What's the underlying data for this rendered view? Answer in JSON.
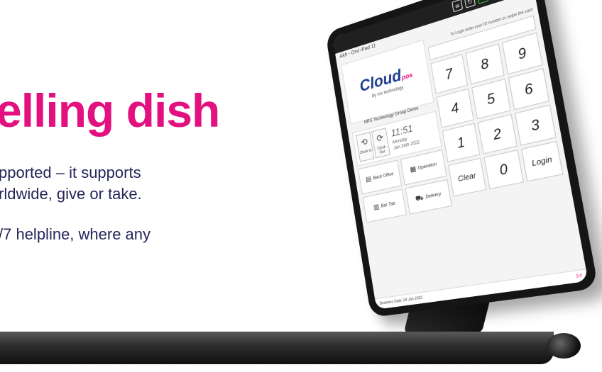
{
  "hero": {
    "headline": "elling dish",
    "para1_line1": "pported – it supports",
    "para1_line2": "rldwide, give or take.",
    "para2_line1": "/7 helpline, where any"
  },
  "pos": {
    "topbar_icons": [
      "clipboard-icon",
      "refresh-icon",
      "monitor-icon",
      "tablet-icon",
      "globe-icon",
      "logout-icon"
    ],
    "title": "Akh - Orvi iPad 11",
    "logo_main": "Cloud",
    "logo_suffix": "pos",
    "logo_sub": "by nrs technology",
    "company": "NRS Technology Group Demo",
    "clock_in": "Clock In",
    "clock_out": "Clock Out",
    "time": "11:51",
    "day": "Monday",
    "date": "Jan 24th 2022",
    "back_office": "Back Office",
    "operation": "Operation",
    "bar_tab": "Bar Tab",
    "delivery": "Delivery",
    "login_hint": "To Login enter your ID number or swipe the card",
    "keys": [
      "7",
      "8",
      "9",
      "4",
      "5",
      "6",
      "1",
      "2",
      "3",
      "Clear",
      "0",
      "Login"
    ],
    "business_date": "Business Date: 24 Jan 2022",
    "version": "3.0"
  }
}
